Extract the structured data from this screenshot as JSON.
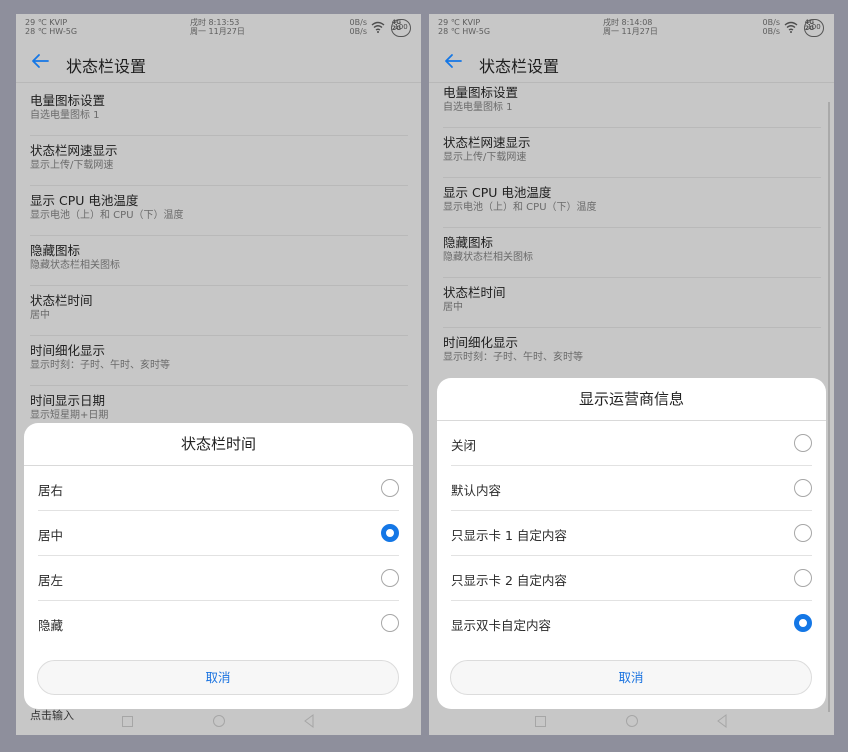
{
  "screens": [
    {
      "status": {
        "carrier_line1": "29 ℃ KVIP",
        "carrier_line2": "28 ℃ HW-5G",
        "time": "戌时 8:13:53",
        "date": "周一 11月27日",
        "speed_up": "0B/s",
        "speed_down": "0B/s",
        "network": "4G",
        "network2": "2G",
        "battery": "100"
      },
      "title": "状态栏设置",
      "items": [
        {
          "title": "电量图标设置",
          "subtitle": "自选电量图标 1"
        },
        {
          "title": "状态栏网速显示",
          "subtitle": "显示上传/下载网速"
        },
        {
          "title": "显示 CPU 电池温度",
          "subtitle": "显示电池（上）和 CPU（下）温度"
        },
        {
          "title": "隐藏图标",
          "subtitle": "隐藏状态栏相关图标"
        },
        {
          "title": "状态栏时间",
          "subtitle": "居中"
        },
        {
          "title": "时间细化显示",
          "subtitle": "显示时刻：子时、午时、亥时等"
        },
        {
          "title": "时间显示日期",
          "subtitle": "显示短星期+日期"
        }
      ],
      "peek_text": "点击输入",
      "dialog": {
        "title": "状态栏时间",
        "options": [
          {
            "label": "居右",
            "selected": false
          },
          {
            "label": "居中",
            "selected": true
          },
          {
            "label": "居左",
            "selected": false
          },
          {
            "label": "隐藏",
            "selected": false
          }
        ],
        "cancel": "取消"
      }
    },
    {
      "status": {
        "carrier_line1": "29 ℃ KVIP",
        "carrier_line2": "28 ℃ HW-5G",
        "time": "戌时 8:14:08",
        "date": "周一 11月27日",
        "speed_up": "0B/s",
        "speed_down": "0B/s",
        "network": "4G",
        "network2": "2G",
        "battery": "100"
      },
      "title": "状态栏设置",
      "items": [
        {
          "title": "电量图标设置",
          "subtitle": "自选电量图标 1"
        },
        {
          "title": "状态栏网速显示",
          "subtitle": "显示上传/下载网速"
        },
        {
          "title": "显示 CPU 电池温度",
          "subtitle": "显示电池（上）和 CPU（下）温度"
        },
        {
          "title": "隐藏图标",
          "subtitle": "隐藏状态栏相关图标"
        },
        {
          "title": "状态栏时间",
          "subtitle": "居中"
        },
        {
          "title": "时间细化显示",
          "subtitle": "显示时刻：子时、午时、亥时等"
        }
      ],
      "dialog": {
        "title": "显示运营商信息",
        "options": [
          {
            "label": "关闭",
            "selected": false
          },
          {
            "label": "默认内容",
            "selected": false
          },
          {
            "label": "只显示卡 1 自定内容",
            "selected": false
          },
          {
            "label": "只显示卡 2 自定内容",
            "selected": false
          },
          {
            "label": "显示双卡自定内容",
            "selected": true
          }
        ],
        "cancel": "取消"
      }
    }
  ],
  "colors": {
    "accent": "#1477e6",
    "background": "#8e8f9c",
    "dim_screen": "#c7c7c7"
  }
}
